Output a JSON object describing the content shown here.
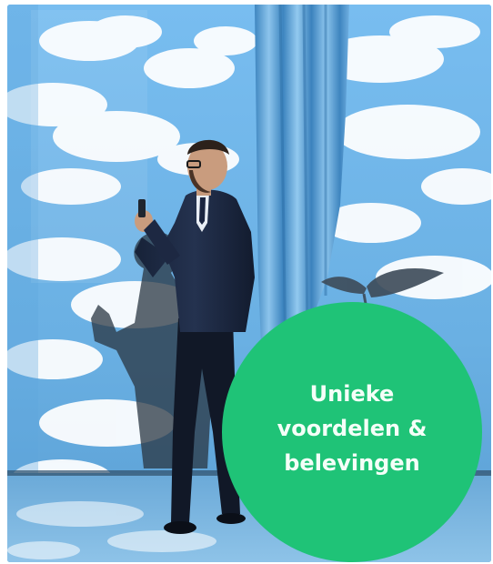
{
  "badge": {
    "lines": [
      "Unieke",
      "voordelen &",
      "belevingen"
    ],
    "color": "#1fc377",
    "text_color": "#f4fff8"
  },
  "scene": {
    "sky_color": "#6fb6e8",
    "curtain_color": "#4f97cf",
    "suit_color": "#1c2a45"
  }
}
